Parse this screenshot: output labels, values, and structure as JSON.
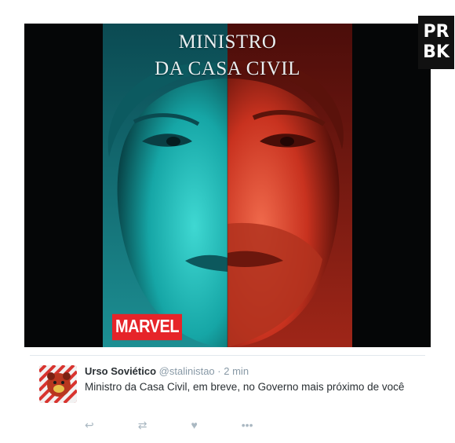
{
  "poster": {
    "title_line1": "MINISTRO",
    "title_line2": "DA CASA CIVIL",
    "logo_text": "MARVEL",
    "colors": {
      "left_tint": "#27c6c4",
      "right_tint": "#e0452f",
      "logo": "#e62429"
    }
  },
  "watermark": {
    "line1": "PR",
    "line2": "BK"
  },
  "tweet": {
    "name": "Urso Soviético",
    "handle": "@stalinistao",
    "separator": "·",
    "time": "2 min",
    "text": "Ministro da Casa Civil, em breve, no Governo mais próximo de você",
    "avatar_icon": "bear-avatar-icon"
  }
}
